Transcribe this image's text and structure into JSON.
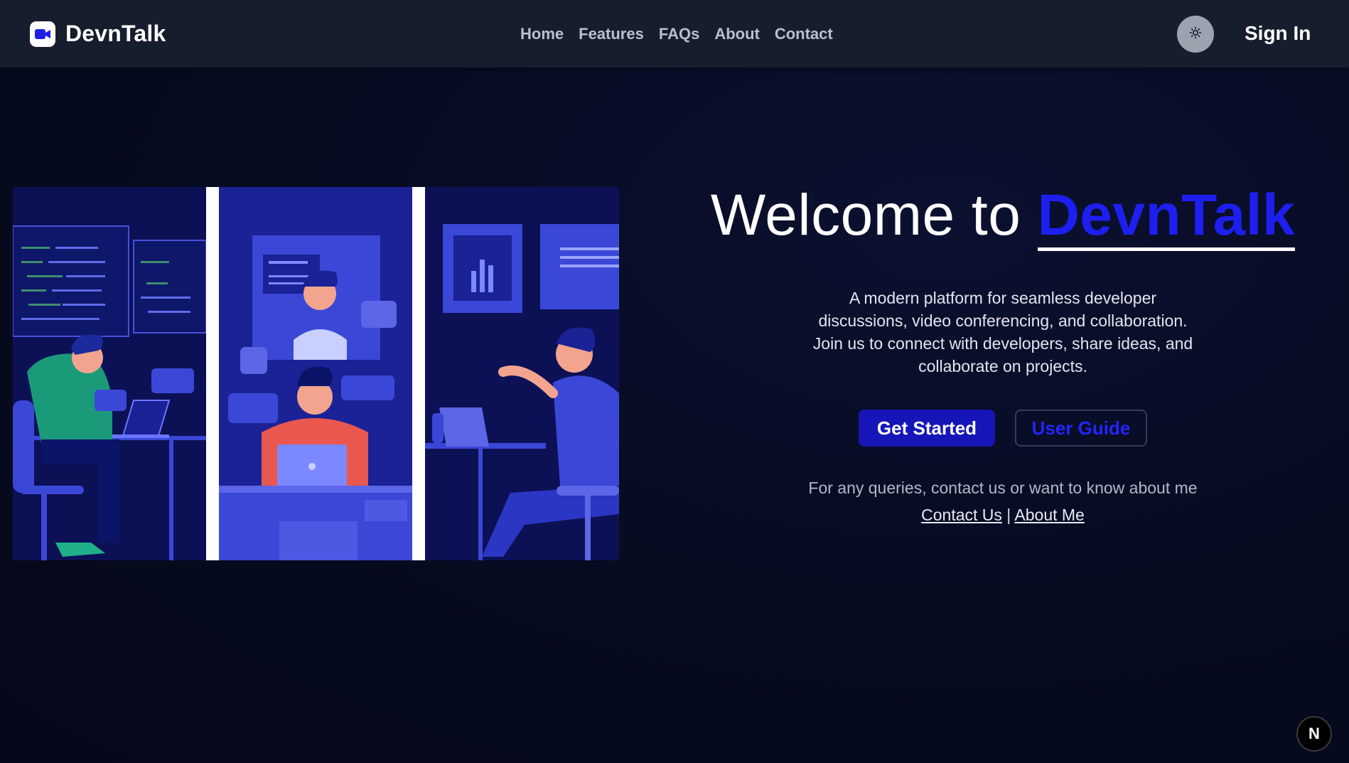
{
  "nav": {
    "brand": "DevnTalk",
    "brand_icon": "video-camera-icon",
    "links": [
      "Home",
      "Features",
      "FAQs",
      "About",
      "Contact"
    ],
    "theme_icon": "sun-icon",
    "sign_in": "Sign In"
  },
  "hero": {
    "title_prefix": "Welcome to ",
    "title_brand": "DevnTalk",
    "description": "A modern platform for seamless developer discussions, video conferencing, and collaboration. Join us to connect with developers, share ideas, and collaborate on projects.",
    "primary_button": "Get Started",
    "secondary_button": "User Guide",
    "query_text": "For any queries, contact us or want to know about me",
    "contact_link": "Contact Us",
    "separator": "|",
    "about_link": "About Me",
    "image_icon": "developers-collaborating-illustration"
  },
  "dev_badge": {
    "label": "N",
    "icon": "nextjs-logo-icon"
  },
  "colors": {
    "background": "#070b1f",
    "navbar": "#161d2c",
    "accent": "#1d1ff0",
    "primary_button": "#1616b8",
    "illustration_blue": "#3b47d6",
    "illustration_dark": "#0c1156"
  }
}
